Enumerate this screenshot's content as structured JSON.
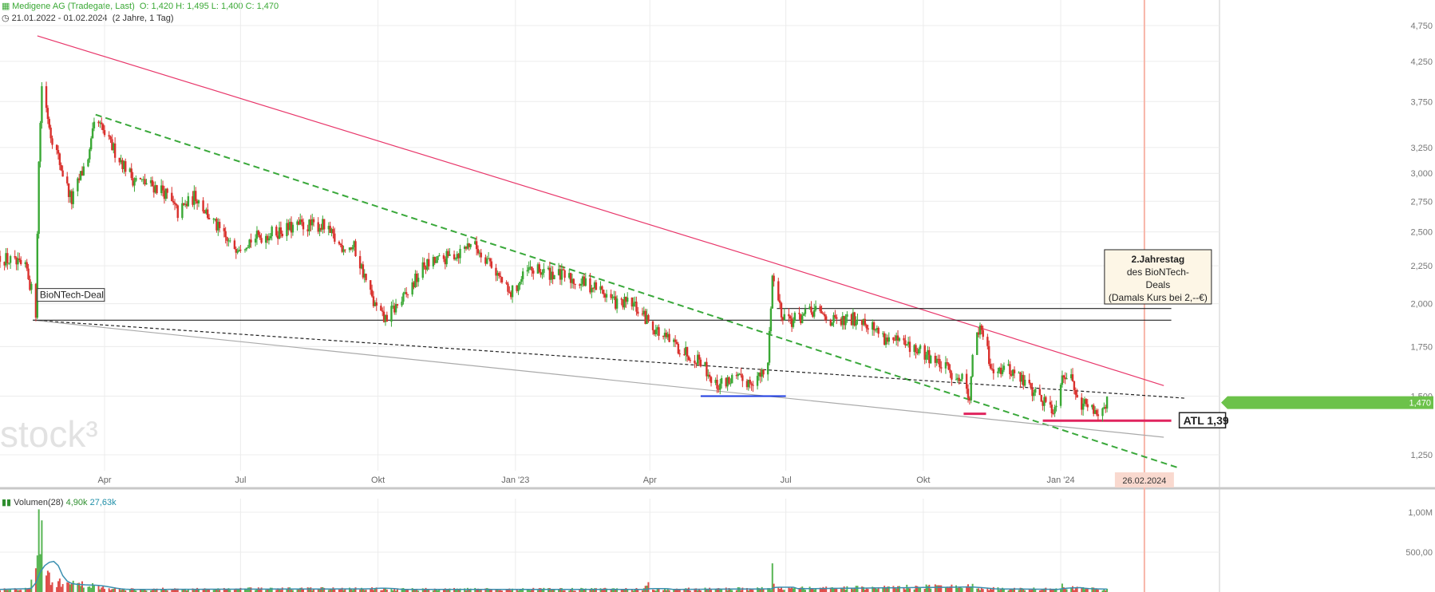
{
  "header": {
    "title": "Medigene AG (Tradegate, Last)",
    "ohlc": "O: 1,420  H: 1,495  L: 1,400  C: 1,470",
    "range": "21.01.2022 - 01.02.2024",
    "interval": "(2 Jahre, 1 Tag)"
  },
  "volume_panel": {
    "label": "Volumen(28)",
    "value1": "4,90k",
    "value2": "27,63k",
    "value1_color": "#2f8f2f",
    "value2_color": "#1f8fa8"
  },
  "colors": {
    "up": "#3aa835",
    "down": "#d9302c",
    "resistance": "#e8366a",
    "channel_dash": "#39a83a",
    "support_gray": "#aaaaaa",
    "marker_line": "#f7b5a8",
    "last_price_badge": "#6cc24a",
    "volume_ma": "#3a8fb0"
  },
  "chart_data": {
    "type": "candlestick",
    "title": "Medigene AG (Tradegate, Last)",
    "x_ticks": [
      {
        "date": "2022-04-01",
        "label": "Apr"
      },
      {
        "date": "2022-07-01",
        "label": "Jul"
      },
      {
        "date": "2022-10-01",
        "label": "Okt"
      },
      {
        "date": "2023-01-01",
        "label": "Jan '23"
      },
      {
        "date": "2023-04-01",
        "label": "Apr"
      },
      {
        "date": "2023-07-01",
        "label": "Jul"
      },
      {
        "date": "2023-10-01",
        "label": "Okt"
      },
      {
        "date": "2024-01-01",
        "label": "Jan '24"
      }
    ],
    "y_ticks": [
      {
        "value": 1.25,
        "label": "1,250"
      },
      {
        "value": 1.5,
        "label": "1,500"
      },
      {
        "value": 1.75,
        "label": "1,750"
      },
      {
        "value": 2.0,
        "label": "2,000"
      },
      {
        "value": 2.25,
        "label": "2,250"
      },
      {
        "value": 2.5,
        "label": "2,500"
      },
      {
        "value": 2.75,
        "label": "2,750"
      },
      {
        "value": 3.0,
        "label": "3,000"
      },
      {
        "value": 3.25,
        "label": "3,250"
      },
      {
        "value": 3.75,
        "label": "3,750"
      },
      {
        "value": 4.25,
        "label": "4,250"
      },
      {
        "value": 4.75,
        "label": "4,750"
      }
    ],
    "y_scale": "log",
    "grid": true,
    "last_price": {
      "value": 1.47,
      "label": "1,470"
    },
    "price_keypoints": [
      [
        "2022-01-21",
        2.32
      ],
      [
        "2022-02-08",
        2.22
      ],
      [
        "2022-02-14",
        1.95
      ],
      [
        "2022-02-16",
        3.1
      ],
      [
        "2022-02-18",
        3.95
      ],
      [
        "2022-02-24",
        3.4
      ],
      [
        "2022-03-05",
        2.95
      ],
      [
        "2022-03-10",
        2.75
      ],
      [
        "2022-03-22",
        3.2
      ],
      [
        "2022-03-26",
        3.55
      ],
      [
        "2022-04-04",
        3.3
      ],
      [
        "2022-04-20",
        2.95
      ],
      [
        "2022-05-10",
        2.85
      ],
      [
        "2022-05-20",
        2.65
      ],
      [
        "2022-06-01",
        2.8
      ],
      [
        "2022-06-10",
        2.62
      ],
      [
        "2022-06-25",
        2.38
      ],
      [
        "2022-07-10",
        2.45
      ],
      [
        "2022-07-25",
        2.5
      ],
      [
        "2022-08-10",
        2.55
      ],
      [
        "2022-08-25",
        2.55
      ],
      [
        "2022-09-05",
        2.4
      ],
      [
        "2022-09-15",
        2.38
      ],
      [
        "2022-09-28",
        2.0
      ],
      [
        "2022-10-05",
        1.9
      ],
      [
        "2022-10-20",
        2.05
      ],
      [
        "2022-11-01",
        2.25
      ],
      [
        "2022-11-15",
        2.3
      ],
      [
        "2022-11-25",
        2.35
      ],
      [
        "2022-12-02",
        2.42
      ],
      [
        "2022-12-15",
        2.28
      ],
      [
        "2022-12-28",
        2.05
      ],
      [
        "2023-01-10",
        2.22
      ],
      [
        "2023-01-25",
        2.2
      ],
      [
        "2023-02-10",
        2.15
      ],
      [
        "2023-02-25",
        2.1
      ],
      [
        "2023-03-10",
        2.0
      ],
      [
        "2023-03-20",
        2.0
      ],
      [
        "2023-03-28",
        1.92
      ],
      [
        "2023-04-10",
        1.8
      ],
      [
        "2023-04-25",
        1.72
      ],
      [
        "2023-05-05",
        1.68
      ],
      [
        "2023-05-15",
        1.55
      ],
      [
        "2023-05-25",
        1.58
      ],
      [
        "2023-06-05",
        1.57
      ],
      [
        "2023-06-15",
        1.6
      ],
      [
        "2023-06-19",
        1.65
      ],
      [
        "2023-06-22",
        2.18
      ],
      [
        "2023-06-28",
        1.95
      ],
      [
        "2023-07-05",
        1.9
      ],
      [
        "2023-07-20",
        1.95
      ],
      [
        "2023-08-05",
        1.88
      ],
      [
        "2023-08-20",
        1.92
      ],
      [
        "2023-09-05",
        1.8
      ],
      [
        "2023-09-20",
        1.75
      ],
      [
        "2023-10-05",
        1.7
      ],
      [
        "2023-10-18",
        1.62
      ],
      [
        "2023-10-28",
        1.58
      ],
      [
        "2023-11-01",
        1.5
      ],
      [
        "2023-11-05",
        1.85
      ],
      [
        "2023-11-10",
        1.82
      ],
      [
        "2023-11-15",
        1.65
      ],
      [
        "2023-11-30",
        1.62
      ],
      [
        "2023-12-10",
        1.55
      ],
      [
        "2023-12-20",
        1.48
      ],
      [
        "2023-12-28",
        1.44
      ],
      [
        "2024-01-02",
        1.62
      ],
      [
        "2024-01-08",
        1.58
      ],
      [
        "2024-01-15",
        1.47
      ],
      [
        "2024-01-25",
        1.43
      ],
      [
        "2024-02-01",
        1.47
      ]
    ],
    "volume_keypoints": [
      [
        "2022-01-21",
        0.05
      ],
      [
        "2022-02-10",
        0.05
      ],
      [
        "2022-02-15",
        0.75
      ],
      [
        "2022-02-16",
        1.12
      ],
      [
        "2022-02-17",
        0.85
      ],
      [
        "2022-02-20",
        0.4
      ],
      [
        "2022-02-25",
        0.15
      ],
      [
        "2022-03-05",
        0.12
      ],
      [
        "2022-03-25",
        0.1
      ],
      [
        "2022-04-05",
        0.04
      ],
      [
        "2022-09-28",
        0.05
      ],
      [
        "2022-09-30",
        0.12
      ],
      [
        "2022-10-03",
        0.04
      ],
      [
        "2023-03-28",
        0.04
      ],
      [
        "2023-03-31",
        0.1
      ],
      [
        "2023-04-03",
        0.04
      ],
      [
        "2023-06-21",
        0.05
      ],
      [
        "2023-06-22",
        0.28
      ],
      [
        "2023-06-23",
        0.12
      ],
      [
        "2023-06-26",
        0.05
      ],
      [
        "2023-11-03",
        0.08
      ],
      [
        "2023-11-05",
        0.05
      ],
      [
        "2024-01-01",
        0.04
      ],
      [
        "2024-01-02",
        0.2
      ],
      [
        "2024-01-04",
        0.06
      ],
      [
        "2024-02-01",
        0.04
      ]
    ],
    "volume_y_ticks": [
      {
        "value": 0.5,
        "label": "500,00"
      },
      {
        "value": 1.0,
        "label": "1,00M"
      }
    ],
    "trendlines": [
      {
        "name": "resistance",
        "points": [
          [
            "2022-02-15",
            4.6
          ],
          [
            "2023-06-20",
            2.28
          ],
          [
            "2024-03-10",
            1.55
          ]
        ],
        "style": "solid",
        "color": "#e8366a"
      },
      {
        "name": "green-dashed-channel",
        "points": [
          [
            "2022-03-26",
            3.6
          ],
          [
            "2024-03-20",
            1.2
          ]
        ],
        "style": "dashed",
        "color": "#39a83a"
      },
      {
        "name": "black-dashed-support",
        "points": [
          [
            "2022-02-12",
            1.9
          ],
          [
            "2024-03-25",
            1.49
          ]
        ],
        "style": "dashed",
        "color": "#222222"
      },
      {
        "name": "gray-support",
        "points": [
          [
            "2022-02-12",
            1.9
          ],
          [
            "2024-03-10",
            1.32
          ]
        ],
        "style": "solid",
        "color": "#aaaaaa"
      },
      {
        "name": "horizontal-support",
        "points": [
          [
            "2022-02-12",
            1.9
          ],
          [
            "2024-03-15",
            1.9
          ]
        ],
        "style": "solid",
        "color": "#222222"
      },
      {
        "name": "upper-range",
        "points": [
          [
            "2023-06-25",
            1.97
          ],
          [
            "2024-03-15",
            1.97
          ]
        ],
        "style": "solid",
        "color": "#222222"
      },
      {
        "name": "blue-low",
        "points": [
          [
            "2023-05-05",
            1.5
          ],
          [
            "2023-07-01",
            1.5
          ]
        ],
        "style": "solid",
        "color": "#1c3be0"
      },
      {
        "name": "red-low-1",
        "points": [
          [
            "2023-10-28",
            1.42
          ],
          [
            "2023-11-12",
            1.42
          ]
        ],
        "style": "solid",
        "color": "#e0245e"
      },
      {
        "name": "atl",
        "points": [
          [
            "2023-12-20",
            1.39
          ],
          [
            "2024-03-15",
            1.39
          ]
        ],
        "style": "solid",
        "color": "#e0245e"
      }
    ],
    "annotations": [
      {
        "date": "2022-02-14",
        "value": 2.05,
        "text": "BioNTech-Deal"
      },
      {
        "date": "2024-03-15",
        "value": 1.39,
        "text": "ATL 1,39"
      },
      {
        "date": "2024-02-26",
        "value": 2.05,
        "text": [
          "2.Jahrestag",
          "des BioNTech-",
          "Deals",
          "(Damals Kurs bei 2,--€)"
        ]
      }
    ],
    "marker": {
      "date": "2024-02-26",
      "label": "26.02.2024"
    }
  }
}
